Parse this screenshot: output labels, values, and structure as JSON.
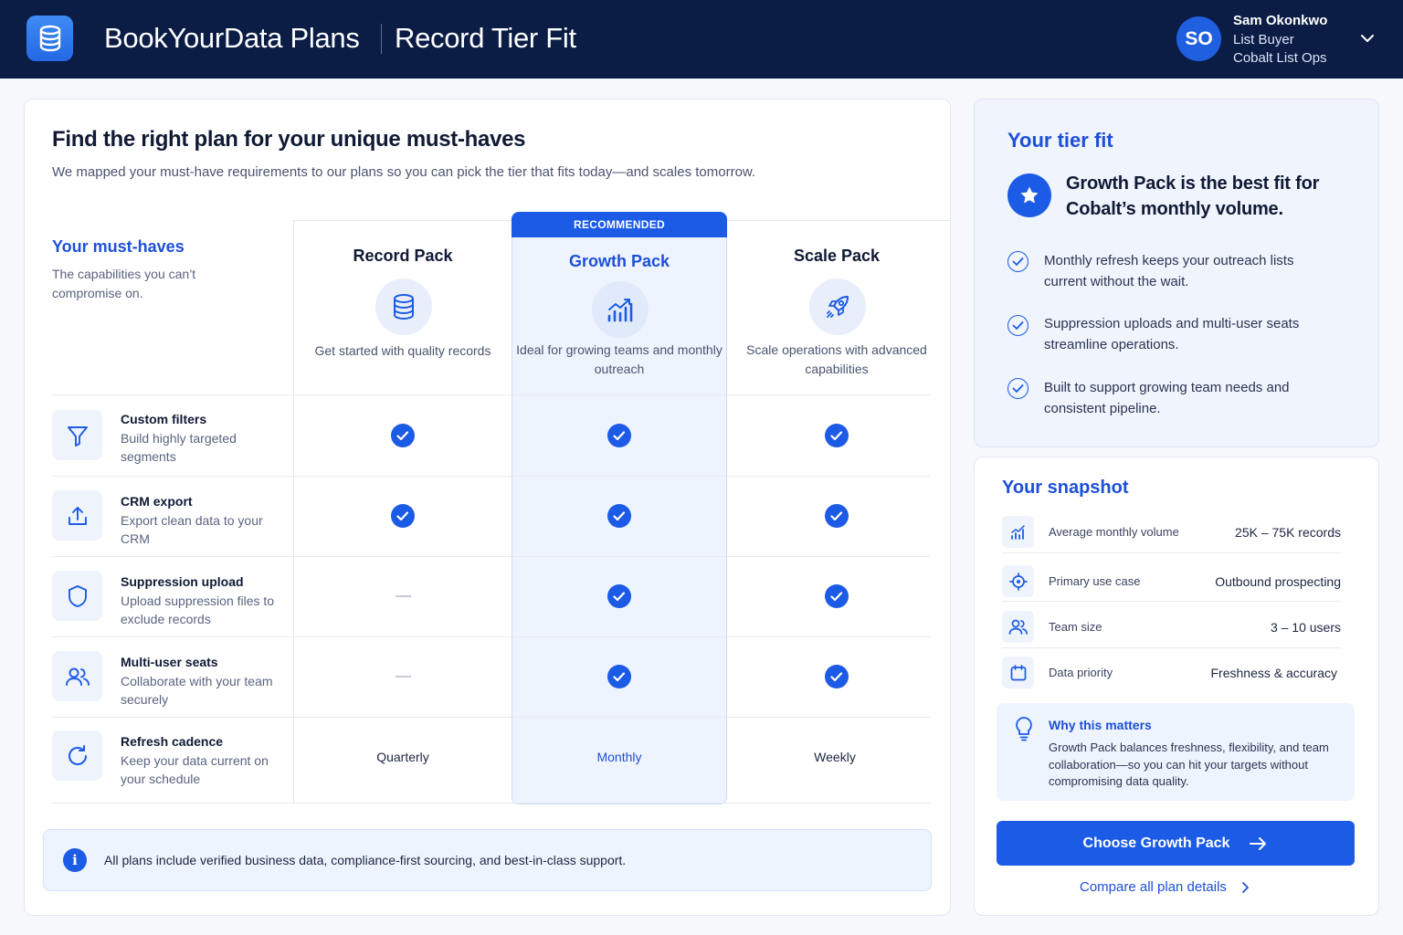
{
  "header": {
    "app_title": "BookYourData Plans",
    "page_title": "Record Tier Fit",
    "user": {
      "initials": "SO",
      "name": "Sam Okonkwo",
      "role": "List Buyer",
      "org": "Cobalt List Ops"
    }
  },
  "main": {
    "heading": "Find the right plan for your unique must-haves",
    "subheading": "We mapped your must-have requirements to our plans so you can pick the tier that fits today—and scales tomorrow.",
    "musthaves_title": "Your must-haves",
    "musthaves_desc": "The capabilities you can’t compromise on.",
    "recommended_label": "RECOMMENDED",
    "plans": [
      {
        "name": "Record Pack",
        "icon": "database-icon",
        "desc": "Get started with quality records"
      },
      {
        "name": "Growth Pack",
        "icon": "chart-growth-icon",
        "desc": "Ideal for growing teams and monthly outreach"
      },
      {
        "name": "Scale Pack",
        "icon": "rocket-icon",
        "desc": "Scale operations with advanced capabilities"
      }
    ],
    "features": [
      {
        "title": "Custom filters",
        "desc": "Build highly targeted segments",
        "icon": "filter-icon",
        "support": [
          true,
          true,
          true
        ]
      },
      {
        "title": "CRM export",
        "desc": "Export clean data to your CRM",
        "icon": "upload-icon",
        "support": [
          true,
          true,
          true
        ]
      },
      {
        "title": "Suppression upload",
        "desc": "Upload suppression files to exclude records",
        "icon": "shield-icon",
        "support": [
          false,
          true,
          true
        ]
      },
      {
        "title": "Multi-user seats",
        "desc": "Collaborate with your team securely",
        "icon": "users-icon",
        "support": [
          false,
          true,
          true
        ]
      },
      {
        "title": "Refresh cadence",
        "desc": "Keep your data current on your schedule",
        "icon": "refresh-icon",
        "cadence": [
          "Quarterly",
          "Monthly",
          "Weekly"
        ]
      }
    ],
    "info_banner": "All plans include verified business data, compliance-first sourcing, and best-in-class support."
  },
  "tier_fit": {
    "title": "Your tier fit",
    "headline": "Growth Pack is the best fit for Cobalt’s monthly volume.",
    "reasons": [
      "Monthly refresh keeps your outreach lists current without the wait.",
      "Suppression uploads and multi-user seats streamline operations.",
      "Built to support growing team needs and consistent pipeline."
    ]
  },
  "snapshot": {
    "title": "Your snapshot",
    "rows": [
      {
        "icon": "bar-chart-icon",
        "label": "Average monthly volume",
        "value": "25K – 75K records"
      },
      {
        "icon": "target-icon",
        "label": "Primary use case",
        "value": "Outbound prospecting"
      },
      {
        "icon": "users-icon",
        "label": "Team size",
        "value": "3 – 10 users"
      },
      {
        "icon": "calendar-icon",
        "label": "Data priority",
        "value": "Freshness & accuracy"
      }
    ],
    "why_title": "Why this matters",
    "why_text": "Growth Pack balances freshness, flexibility, and team collaboration—so you can hit your targets without compromising data quality.",
    "cta_label": "Choose Growth Pack",
    "compare_label": "Compare all plan details"
  },
  "colors": {
    "header_bg": "#0b1c45",
    "accent": "#1c5be6",
    "accent_text": "#1d4fd8",
    "highlight_bg": "#eef4fe"
  }
}
